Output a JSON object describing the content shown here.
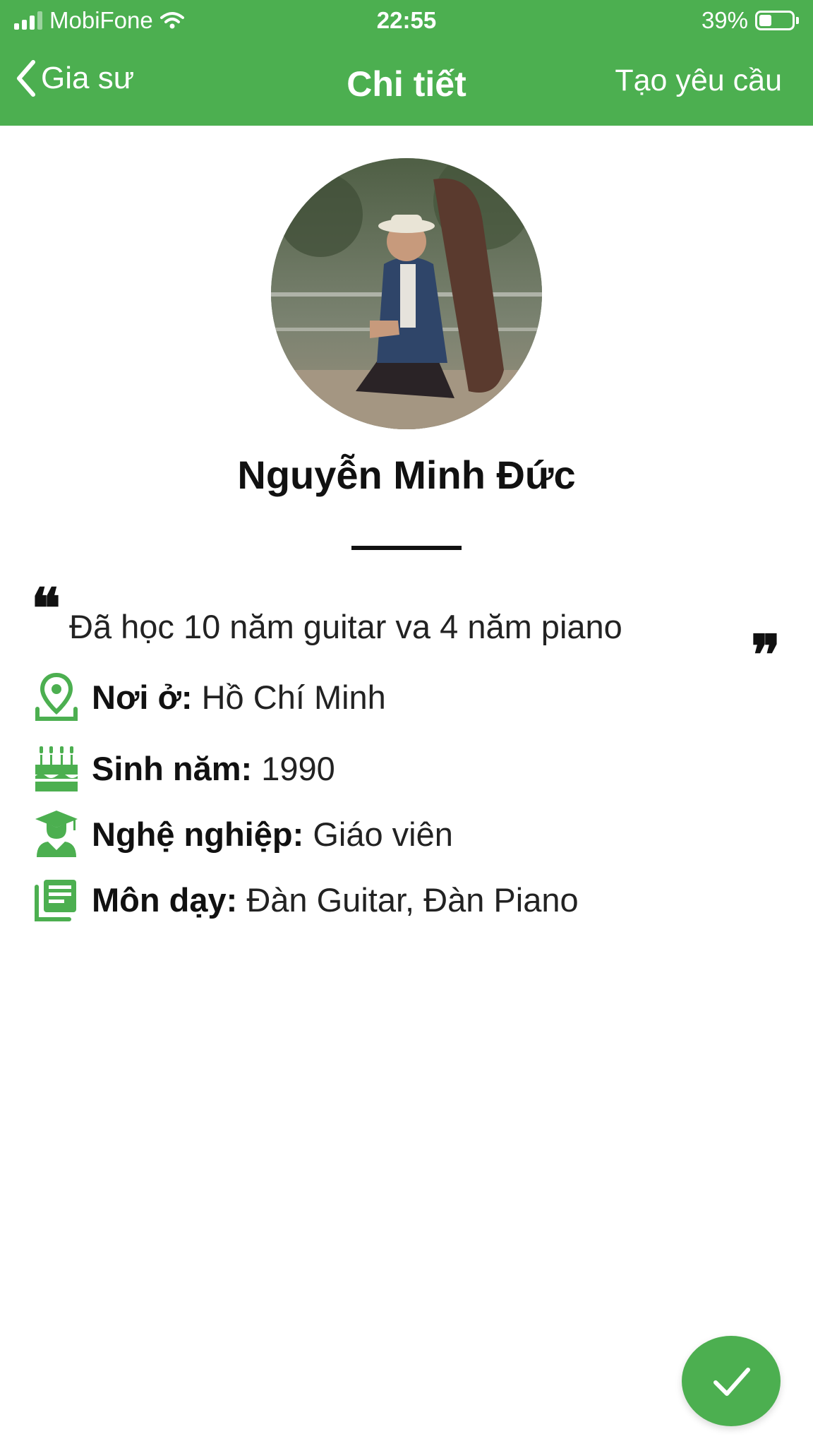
{
  "status_bar": {
    "carrier": "MobiFone",
    "time": "22:55",
    "battery_percent": "39%",
    "battery_level": 0.39
  },
  "nav": {
    "back_label": "Gia sư",
    "title": "Chi tiết",
    "action_label": "Tạo yêu cầu"
  },
  "profile": {
    "name": "Nguyễn Minh Đức",
    "bio": "Đã học 10 năm guitar va 4 năm piano",
    "quote_open": "❝",
    "quote_close": "❞"
  },
  "details": {
    "residence_label": "Nơi ở:",
    "residence_value": "Hồ Chí Minh",
    "birth_year_label": "Sinh năm:",
    "birth_year_value": "1990",
    "occupation_label": "Nghệ nghiệp:",
    "occupation_value": "Giáo viên",
    "subjects_label": "Môn dạy:",
    "subjects_value": "Đàn Guitar, Đàn Piano"
  },
  "icons": {
    "back": "chevron-left-icon",
    "signal": "cellular-signal-icon",
    "wifi": "wifi-icon",
    "battery": "battery-icon",
    "residence": "location-pin-icon",
    "birth_year": "birthday-cake-icon",
    "occupation": "graduate-icon",
    "subjects": "document-list-icon",
    "confirm": "checkmark-icon"
  },
  "colors": {
    "primary": "#4caf50",
    "text": "#1c1c1c",
    "on_primary": "#ffffff"
  }
}
